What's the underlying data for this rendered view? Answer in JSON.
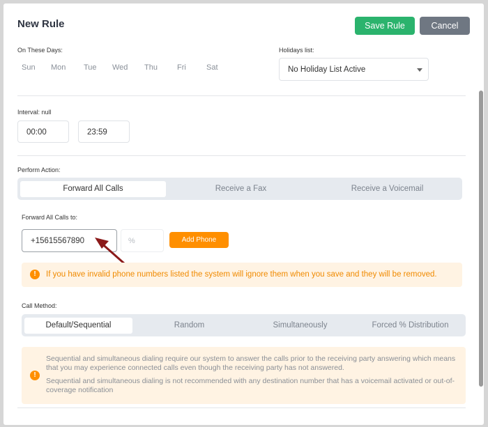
{
  "header": {
    "title": "New Rule",
    "save_label": "Save Rule",
    "cancel_label": "Cancel"
  },
  "days_section": {
    "label": "On These Days:",
    "days": [
      "Sun",
      "Mon",
      "Tue",
      "Wed",
      "Thu",
      "Fri",
      "Sat"
    ]
  },
  "holidays": {
    "label": "Holidays list:",
    "selected": "No Holiday List Active"
  },
  "interval": {
    "label": "Interval: null",
    "start": "00:00",
    "end": "23:59"
  },
  "action": {
    "label": "Perform Action:",
    "tabs": [
      "Forward All Calls",
      "Receive a Fax",
      "Receive a Voicemail"
    ],
    "active_index": 0
  },
  "forward": {
    "label": "Forward All Calls to:",
    "phone_value": "+15615567890",
    "percent_placeholder": "%",
    "add_label": "Add Phone",
    "warning": "If you have invalid phone numbers listed the system will ignore them when you save and they will be removed."
  },
  "call_method": {
    "label": "Call Method:",
    "tabs": [
      "Default/Sequential",
      "Random",
      "Simultaneously",
      "Forced % Distribution"
    ],
    "active_index": 0,
    "notice_1": "Sequential and simultaneous dialing require our system to answer the calls prior to the receiving party answering which means that you may experience connected calls even though the receiving party has not answered.",
    "notice_2": "Sequential and simultaneous dialing is not recommended with any destination number that has a voicemail activated or out-of-coverage notification"
  },
  "colors": {
    "save": "#2bb36d",
    "cancel": "#6f7782",
    "accent": "#ff8f00",
    "arrow": "#8b1a1a"
  }
}
